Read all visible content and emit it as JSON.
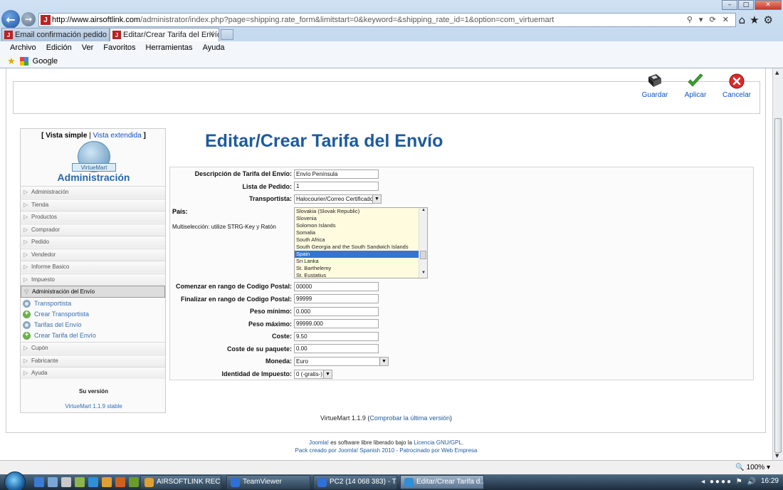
{
  "browser": {
    "url_host": "http://www.airsoftlink.com",
    "url_path": "/administrator/index.php?page=shipping.rate_form&limitstart=0&keyword=&shipping_rate_id=1&option=com_virtuemart",
    "tabs": [
      {
        "label": "Email confirmación pedido y e...",
        "active": false
      },
      {
        "label": "Editar/Crear Tarifa del Envío",
        "active": true
      }
    ],
    "menu": [
      "Archivo",
      "Edición",
      "Ver",
      "Favoritos",
      "Herramientas",
      "Ayuda"
    ],
    "favorites": [
      "Google"
    ],
    "zoom": "100%"
  },
  "toolbar": {
    "save_label": "Guardar",
    "apply_label": "Aplicar",
    "cancel_label": "Cancelar"
  },
  "sidebar": {
    "view_simple": "[ Vista simple",
    "view_sep": " | ",
    "view_extended": "Vista extendida",
    "view_end": " ]",
    "logo_text": "VirtueMart",
    "title": "Administración",
    "items": [
      {
        "label": "Administración"
      },
      {
        "label": "Tienda"
      },
      {
        "label": "Productos"
      },
      {
        "label": "Comprador"
      },
      {
        "label": "Pedido"
      },
      {
        "label": "Vendedor"
      },
      {
        "label": "Informe Basico"
      },
      {
        "label": "Impuesto"
      },
      {
        "label": "Administración del Envío"
      },
      {
        "label": "Cupón"
      },
      {
        "label": "Fabricante"
      },
      {
        "label": "Ayuda"
      }
    ],
    "sub_items": [
      {
        "label": "Transportista",
        "icon": "gear-icon"
      },
      {
        "label": "Crear Transportista",
        "icon": "plus-icon"
      },
      {
        "label": "Tarifas del Envío",
        "icon": "gear-icon"
      },
      {
        "label": "Crear Tarifa del Envío",
        "icon": "plus-icon"
      }
    ],
    "version_label": "Su versión",
    "version_value": "VirtueMart 1.1.9 stable"
  },
  "main": {
    "title": "Editar/Crear Tarifa del Envío",
    "form": {
      "descripcion_label": "Descripción de Tarifa del Envío:",
      "descripcion_value": "Envío Península",
      "lista_label": "Lista de Pedido:",
      "lista_value": "1",
      "transportista_label": "Transportista:",
      "transportista_value": "Halocourier/Correo Certificado",
      "pais_label": "País:",
      "pais_hint": "Multiselección: utilize STRG-Key y Ratón",
      "countries": [
        {
          "name": "Slovakia (Slovak Republic)",
          "selected": false
        },
        {
          "name": "Slovenia",
          "selected": false
        },
        {
          "name": "Solomon Islands",
          "selected": false
        },
        {
          "name": "Somalia",
          "selected": false
        },
        {
          "name": "South Africa",
          "selected": false
        },
        {
          "name": "South Georgia and the South Sandwich Islands",
          "selected": false
        },
        {
          "name": "Spain",
          "selected": true
        },
        {
          "name": "Sri Lanka",
          "selected": false
        },
        {
          "name": "St. Barthelemy",
          "selected": false
        },
        {
          "name": "St. Eustatius",
          "selected": false
        }
      ],
      "cp_start_label": "Comenzar en rango de Codigo Postal:",
      "cp_start_value": "00000",
      "cp_end_label": "Finalizar en rango de Codigo Postal:",
      "cp_end_value": "99999",
      "peso_min_label": "Peso mínimo:",
      "peso_min_value": "0.000",
      "peso_max_label": "Peso máximo:",
      "peso_max_value": "99999.000",
      "coste_label": "Coste:",
      "coste_value": "9.50",
      "coste_paquete_label": "Coste de su paquete:",
      "coste_paquete_value": "0.00",
      "moneda_label": "Moneda:",
      "moneda_value": "Euro",
      "impuesto_label": "Identidad de Impuesto:",
      "impuesto_value": "0 (-gratis-)"
    }
  },
  "footer": {
    "version_text": "VirtueMart 1.1.9 (",
    "version_link": "Comprobar la última versión",
    "version_end": ")",
    "joomla_link": "Joomla!",
    "license_text": " es software libre liberado bajo la ",
    "license_link": "Licencia GNU/GPL",
    "license_end": ".",
    "pack_text": "Pack creado por Joomla! Spanish 2010 - Patrocinado por Web Empresa"
  },
  "taskbar": {
    "tasks": [
      {
        "label": "AIRSOFTLINK RECIB...",
        "active": false
      },
      {
        "label": "TeamViewer",
        "active": false
      },
      {
        "label": "PC2 (14 068 383) - T...",
        "active": false
      },
      {
        "label": "Editar/Crear Tarifa d...",
        "active": true
      }
    ],
    "clock": "16:29"
  },
  "colors": {
    "title_blue": "#1e5a9e",
    "link_blue": "#0b55c4",
    "selected_country": "#3375d6",
    "country_list_bg": "#fffbdf"
  }
}
